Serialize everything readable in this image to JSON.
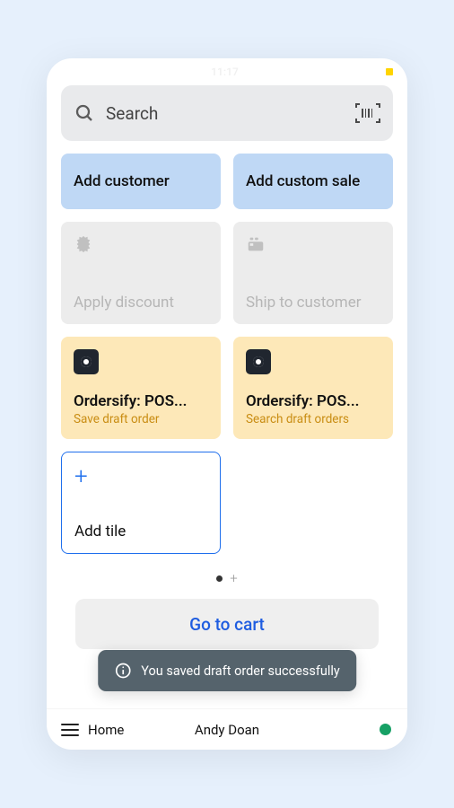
{
  "search": {
    "placeholder": "Search"
  },
  "tiles": {
    "add_customer": "Add customer",
    "add_custom_sale": "Add custom sale",
    "apply_discount": "Apply discount",
    "ship_to_customer": "Ship to customer",
    "ordersify1": {
      "title": "Ordersify: POS...",
      "subtitle": "Save draft order"
    },
    "ordersify2": {
      "title": "Ordersify: POS...",
      "subtitle": "Search draft orders"
    },
    "add_tile": "Add tile"
  },
  "cart_button": "Go to cart",
  "toast_message": "You saved draft order successfully",
  "bottom": {
    "home": "Home",
    "user": "Andy Doan"
  },
  "status_time": "11:17"
}
